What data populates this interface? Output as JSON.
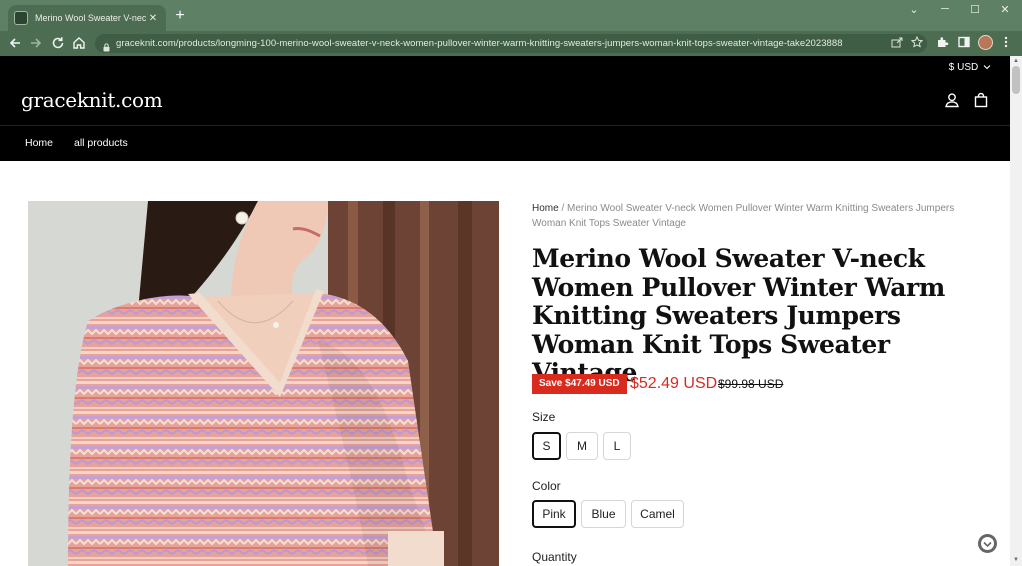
{
  "browser": {
    "tab_title": "Merino Wool Sweater V-neck Wo",
    "tab_close": "✕",
    "new_tab": "+",
    "url": "graceknit.com/products/longming-100-merino-wool-sweater-v-neck-women-pullover-winter-warm-knitting-sweaters-jumpers-woman-knit-tops-sweater-vintage-take2023888",
    "icons": [
      "back-icon",
      "forward-icon",
      "reload-icon",
      "home-icon",
      "lock-icon",
      "share-icon",
      "star-icon",
      "extensions-icon",
      "side-panel-icon",
      "profile-avatar",
      "kebab-menu-icon"
    ],
    "window_controls": {
      "chevron": "⌄",
      "minimize": "─",
      "maximize": "☐",
      "close": "✕"
    }
  },
  "store": {
    "currency": "$ USD",
    "logo": "graceknit.com",
    "nav": [
      "Home",
      "all products"
    ]
  },
  "product": {
    "breadcrumb_home": "Home",
    "breadcrumb_sep": " / ",
    "breadcrumb_current": "Merino Wool Sweater V-neck Women Pullover Winter Warm Knitting Sweaters Jumpers Woman Knit Tops Sweater Vintage",
    "title": "Merino Wool Sweater V-neck Women Pullover Winter Warm Knitting Sweaters Jumpers Woman Knit Tops Sweater Vintage",
    "save_badge": "Save $47.49 USD",
    "price": "$52.49 USD",
    "compare_price": "$99.98 USD",
    "size_label": "Size",
    "sizes": [
      "S",
      "M",
      "L"
    ],
    "selected_size": "S",
    "color_label": "Color",
    "colors": [
      "Pink",
      "Blue",
      "Camel"
    ],
    "selected_color": "Pink",
    "quantity_label": "Quantity"
  },
  "colors": {
    "tabbar_bg": "#5e8064",
    "toolbar_bg": "#4d6d52",
    "header_bg": "#000000",
    "sale_red": "#d92a1e"
  }
}
